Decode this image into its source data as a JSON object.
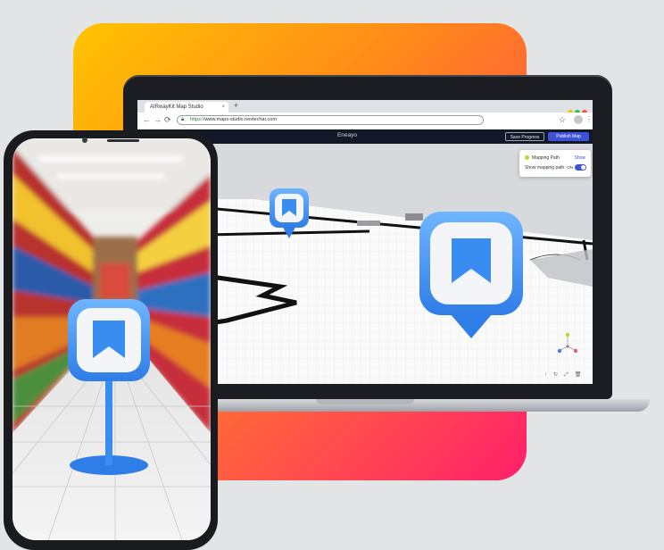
{
  "browser": {
    "tab_title": "AIRwayKit Map Studio",
    "tab_close": "×",
    "new_tab": "+",
    "url_protocol": "https://",
    "url_rest": "www.maps-studio.nextechar.com",
    "window_dots": [
      "#f5c400",
      "#2fbf4a",
      "#ff4d3d"
    ]
  },
  "app": {
    "title": "Eneayo",
    "save_label": "Save Progress",
    "publish_label": "Publish Map",
    "accent": "#3f51d6"
  },
  "panel": {
    "mapping_path_label": "Mapping Path",
    "show_link": "Show",
    "show_mapping_path_label": "Show mapping path",
    "toggle_state": "ON"
  },
  "icons": {
    "back": "back-arrow-icon",
    "forward": "forward-arrow-icon",
    "reload": "reload-icon",
    "lock": "lock-icon",
    "star": "star-icon",
    "bookmark": "bookmark-icon",
    "axis": "axis-gizmo-icon"
  },
  "brand_gradient": [
    "#ffc400",
    "#ff8a1a",
    "#ff4d4d",
    "#ff1f6b"
  ]
}
